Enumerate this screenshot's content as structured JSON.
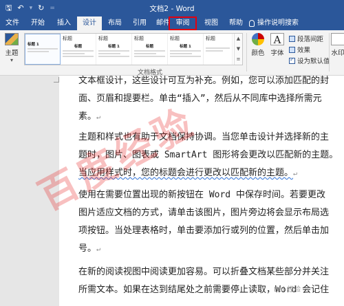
{
  "window": {
    "title": "文档2 - Word"
  },
  "quick_access": {
    "save": "🖫",
    "undo": "↶",
    "undo_dropdown": "▾",
    "redo": "↻",
    "more": "="
  },
  "tabs": [
    {
      "label": "文件",
      "name": "tab-file"
    },
    {
      "label": "开始",
      "name": "tab-home"
    },
    {
      "label": "插入",
      "name": "tab-insert"
    },
    {
      "label": "设计",
      "name": "tab-design"
    },
    {
      "label": "布局",
      "name": "tab-layout"
    },
    {
      "label": "引用",
      "name": "tab-references"
    },
    {
      "label": "邮件",
      "name": "tab-mailings"
    },
    {
      "label": "审阅",
      "name": "tab-review"
    },
    {
      "label": "视图",
      "name": "tab-view"
    },
    {
      "label": "帮助",
      "name": "tab-help"
    }
  ],
  "active_tab": "设计",
  "highlighted_tab": "审阅",
  "search": {
    "label": "操作说明搜索"
  },
  "ribbon": {
    "themes_label": "主题",
    "themes_arrow": "▾",
    "gallery": [
      {
        "heading": "",
        "title": "标题 1"
      },
      {
        "heading": "标题",
        "title": "标题"
      },
      {
        "heading": "标题",
        "title": "标题 1"
      },
      {
        "heading": "标题",
        "title": "标题"
      },
      {
        "heading": "标题",
        "title": "标题 1"
      },
      {
        "heading": "标题",
        "title": ""
      }
    ],
    "group_label": "文档格式",
    "colors_label": "颜色",
    "fonts_label": "字体",
    "paragraph_spacing": "段落间距",
    "effects": "效果",
    "set_default": "设为默认值",
    "watermark": "水印"
  },
  "document": {
    "paragraphs": [
      "文本框设计，这些设计可互为补充。例如，您可以添加匹配的封",
      "面、页眉和提要栏。单击“插入”，然后从不同库中选择所需元",
      "素。",
      "主题和样式也有助于文档保持协调。当您单击设计并选择新的主",
      "题时，图片、图表或 SmartArt 图形将会更改以匹配新的主题。",
      "当应用样式时，您的标题会进行更改以匹配新的主题。",
      "使用在需要位置出现的新按钮在 Word 中保存时间。若要更改",
      "图片适应文档的方式，请单击该图片，图片旁边将会显示布局选",
      "项按钮。当处理表格时，单击要添加行或列的位置，然后单击加",
      "号。",
      "在新的阅读视图中阅读更加容易。可以折叠文档某些部分并关注",
      "所需文本。如果在达到结尾处之前需要停止读取，Word 会记住"
    ],
    "paragraph_mark": "↵"
  },
  "watermark_text": "百度经验",
  "watermark_small": "Bai 经验"
}
